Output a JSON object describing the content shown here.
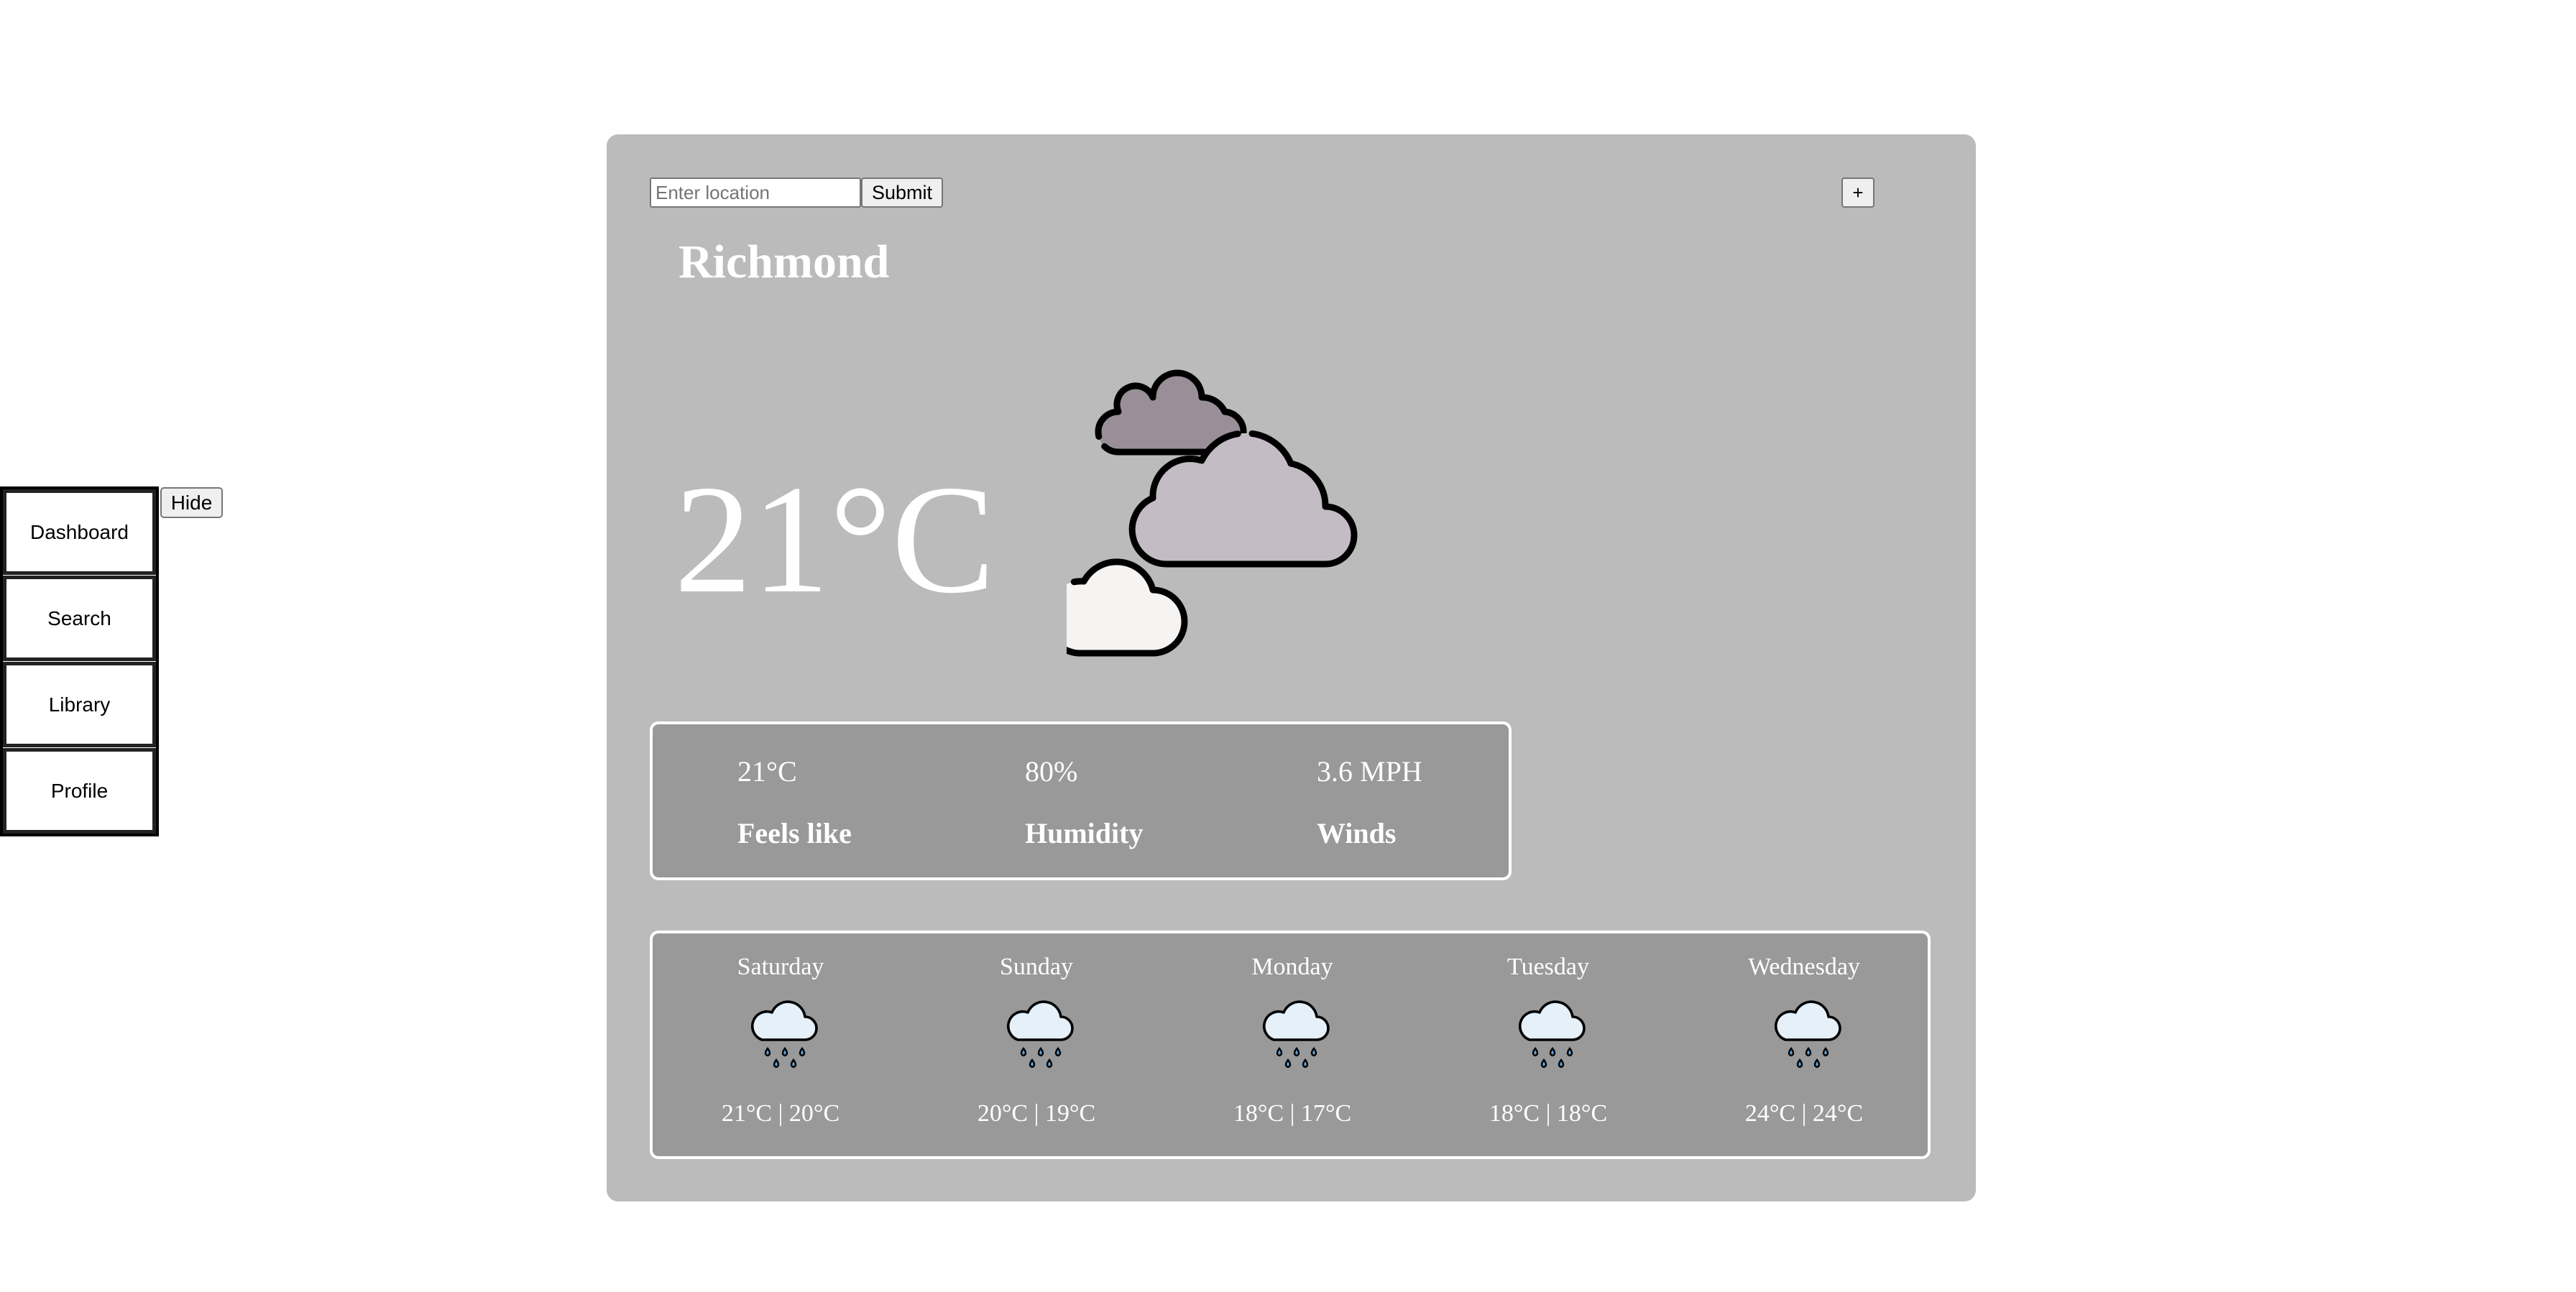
{
  "sidebar": {
    "items": [
      {
        "label": "Dashboard"
      },
      {
        "label": "Search"
      },
      {
        "label": "Library"
      },
      {
        "label": "Profile"
      }
    ],
    "hide_label": "Hide"
  },
  "search": {
    "placeholder": "Enter location",
    "value": "",
    "submit_label": "Submit",
    "add_label": "+"
  },
  "weather": {
    "city": "Richmond",
    "temperature": "21°C",
    "condition_icon": "partly-cloudy-clouds-icon",
    "details": [
      {
        "value": "21°C",
        "label": "Feels like"
      },
      {
        "value": "80%",
        "label": "Humidity"
      },
      {
        "value": "3.6 MPH",
        "label": "Winds"
      }
    ]
  },
  "forecast": [
    {
      "day": "Saturday",
      "icon": "rain-cloud-icon",
      "range": "21°C | 20°C"
    },
    {
      "day": "Sunday",
      "icon": "rain-cloud-icon",
      "range": "20°C | 19°C"
    },
    {
      "day": "Monday",
      "icon": "rain-cloud-icon",
      "range": "18°C | 17°C"
    },
    {
      "day": "Tuesday",
      "icon": "rain-cloud-icon",
      "range": "18°C | 18°C"
    },
    {
      "day": "Wednesday",
      "icon": "rain-cloud-icon",
      "range": "24°C | 24°C"
    }
  ],
  "colors": {
    "card_background": "#bbbbbb",
    "panel_background": "#999999",
    "text": "#ffffff"
  }
}
